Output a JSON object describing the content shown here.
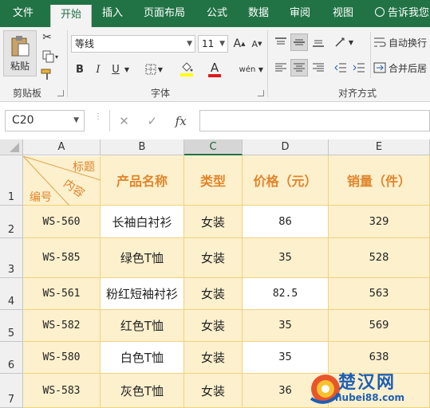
{
  "tabs": [
    "文件",
    "开始",
    "插入",
    "页面布局",
    "公式",
    "数据",
    "审阅",
    "视图"
  ],
  "tell_me": "告诉我您",
  "clipboard": {
    "paste_label": "粘贴",
    "group_label": "剪贴板"
  },
  "font": {
    "name": "等线",
    "size": "11",
    "group_label": "字体",
    "bold": "B",
    "italic": "I",
    "underline": "U",
    "grow": "A",
    "shrink": "A",
    "phonetic": "wén"
  },
  "alignment": {
    "wrap_label": "自动换行",
    "merge_label": "合并后居",
    "group_label": "对齐方式"
  },
  "formula_bar": {
    "name_box": "C20",
    "fx": "fx",
    "cancel": "✕",
    "enter": "✓",
    "value": ""
  },
  "columns": [
    "A",
    "B",
    "C",
    "D",
    "E"
  ],
  "rows": [
    "1",
    "2",
    "3",
    "4",
    "5",
    "6",
    "7"
  ],
  "header": {
    "a_top": "标题",
    "a_mid": "内容",
    "a_bottom": "编号",
    "b": "产品名称",
    "c": "类型",
    "d": "价格（元）",
    "e": "销量（件）"
  },
  "table": [
    {
      "id": "WS-560",
      "name": "长袖白衬衫",
      "type": "女装",
      "price": "86",
      "sales": "329"
    },
    {
      "id": "WS-585",
      "name": "绿色T恤",
      "type": "女装",
      "price": "35",
      "sales": "528"
    },
    {
      "id": "WS-561",
      "name": "粉红短袖衬衫",
      "type": "女装",
      "price": "82.5",
      "sales": "563"
    },
    {
      "id": "WS-582",
      "name": "红色T恤",
      "type": "女装",
      "price": "35",
      "sales": "569"
    },
    {
      "id": "WS-580",
      "name": "白色T恤",
      "type": "女装",
      "price": "35",
      "sales": "638"
    },
    {
      "id": "WS-583",
      "name": "灰色T恤",
      "type": "女装",
      "price": "36",
      "sales": ""
    }
  ],
  "watermark": {
    "text": "楚汉网",
    "url": "hubei88.com"
  },
  "colors": {
    "ribbon_green": "#217346",
    "cell_fill": "#fdf0cd",
    "accent_text": "#e0852b"
  }
}
